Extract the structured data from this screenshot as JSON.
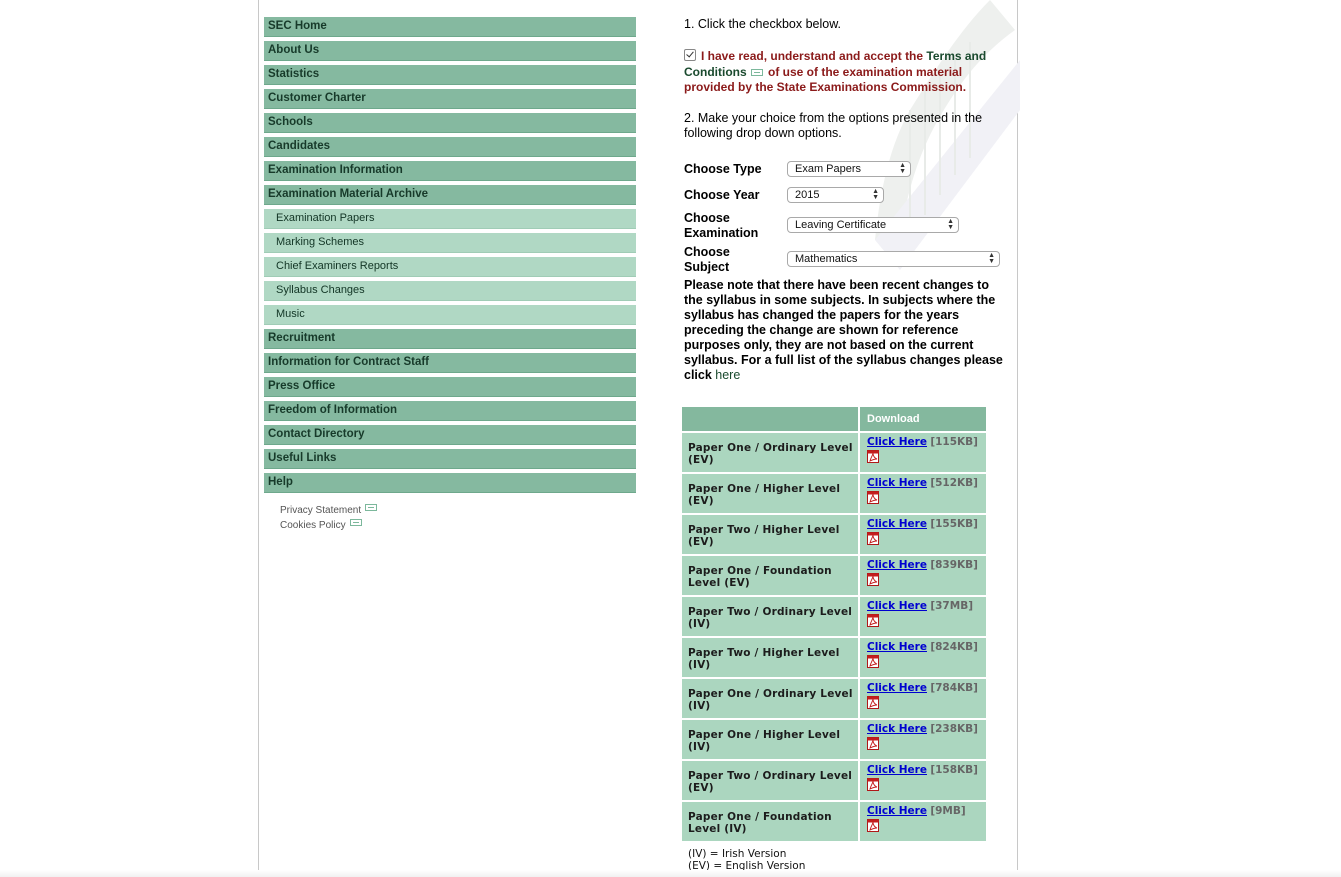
{
  "sidebar": {
    "items": [
      {
        "label": "SEC Home",
        "sub": false
      },
      {
        "label": "About Us",
        "sub": false
      },
      {
        "label": "Statistics",
        "sub": false
      },
      {
        "label": "Customer Charter",
        "sub": false
      },
      {
        "label": "Schools",
        "sub": false
      },
      {
        "label": "Candidates",
        "sub": false
      },
      {
        "label": "Examination Information",
        "sub": false
      },
      {
        "label": "Examination Material Archive",
        "sub": false
      },
      {
        "label": "Examination Papers",
        "sub": true
      },
      {
        "label": "Marking Schemes",
        "sub": true
      },
      {
        "label": "Chief Examiners Reports",
        "sub": true
      },
      {
        "label": "Syllabus Changes",
        "sub": true
      },
      {
        "label": "Music",
        "sub": true
      },
      {
        "label": "Recruitment",
        "sub": false
      },
      {
        "label": "Information for Contract Staff",
        "sub": false
      },
      {
        "label": "Press Office",
        "sub": false
      },
      {
        "label": "Freedom of Information",
        "sub": false
      },
      {
        "label": "Contact Directory",
        "sub": false
      },
      {
        "label": "Useful Links",
        "sub": false
      },
      {
        "label": "Help",
        "sub": false
      }
    ],
    "footer_links": [
      "Privacy Statement",
      "Cookies Policy"
    ]
  },
  "main": {
    "step1": "1. Click the checkbox below.",
    "terms": {
      "checked": true,
      "part1": "I have read, understand and accept the ",
      "link": "Terms and Conditions",
      "part2": " of use of the examination material provided by the State Examinations Commission."
    },
    "step2": "2. Make your choice from the options presented in the following drop down options.",
    "selects": {
      "type": {
        "label": "Choose Type",
        "value": "Exam Papers"
      },
      "year": {
        "label": "Choose Year",
        "value": "2015"
      },
      "exam": {
        "label": "Choose Examination",
        "value": "Leaving Certificate"
      },
      "subject": {
        "label": "Choose Subject",
        "value": "Mathematics"
      }
    },
    "note": {
      "text": "Please note that there have been recent changes to the syllabus in some subjects. In subjects where the syllabus has changed the papers for the years preceding the change are shown for reference purposes only, they are not based on the current syllabus. For a full list of the syllabus changes please click ",
      "link": "here"
    }
  },
  "table": {
    "header_download": "Download",
    "link_label": "Click Here",
    "rows": [
      {
        "name": "Paper One / Ordinary Level (EV)",
        "size": "[115KB]"
      },
      {
        "name": "Paper One / Higher Level (EV)",
        "size": "[512KB]"
      },
      {
        "name": "Paper Two / Higher Level (EV)",
        "size": "[155KB]"
      },
      {
        "name": "Paper One / Foundation Level (EV)",
        "size": "[839KB]"
      },
      {
        "name": "Paper Two / Ordinary Level (IV)",
        "size": "[37MB]"
      },
      {
        "name": "Paper Two / Higher Level (IV)",
        "size": "[824KB]"
      },
      {
        "name": "Paper One / Ordinary Level (IV)",
        "size": "[784KB]"
      },
      {
        "name": "Paper One / Higher Level (IV)",
        "size": "[238KB]"
      },
      {
        "name": "Paper Two / Ordinary Level (EV)",
        "size": "[158KB]"
      },
      {
        "name": "Paper One / Foundation Level (IV)",
        "size": "[9MB]"
      }
    ],
    "legend": [
      "(IV) = Irish Version",
      "(EV) = English Version"
    ]
  },
  "colors": {
    "nav_main": "#85b9a0",
    "nav_sub": "#b0d8c4",
    "terms_text": "#8b1a1a",
    "table_cell": "#abd6bf",
    "link_blue": "#0000d0"
  },
  "icons": [
    "external-link-icon",
    "checkbox-checked-icon",
    "select-arrows-icon",
    "pdf-icon",
    "harp-watermark-icon"
  ]
}
